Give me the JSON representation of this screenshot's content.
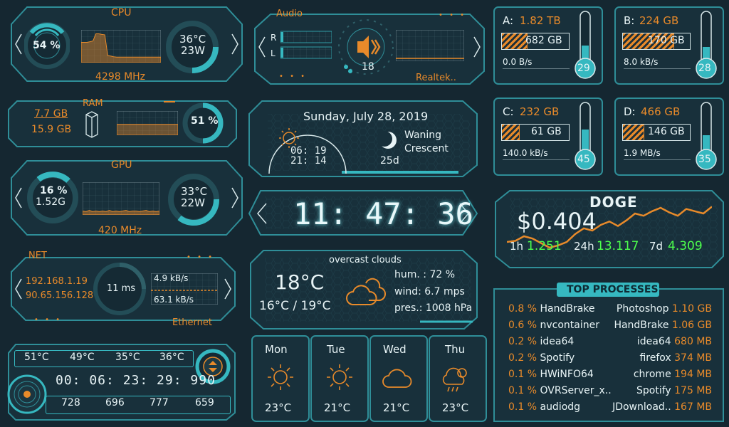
{
  "cpu": {
    "title": "CPU",
    "load": "54 %",
    "temp": "36°C",
    "power": "23W",
    "freq": "4298 MHz",
    "history": [
      0.62,
      0.62,
      0.62,
      0.64,
      0.66,
      0.88,
      0.88,
      0.86,
      0.85,
      0.22,
      0.2,
      0.18,
      0.17,
      0.17,
      0.17,
      0.17,
      0.17,
      0.17,
      0.17,
      0.17,
      0.17,
      0.17,
      0.17,
      0.17,
      0.17,
      0.17,
      0.17,
      0.17
    ]
  },
  "ram": {
    "title": "RAM",
    "used": "7.7 GB",
    "total": "15.9 GB",
    "percent": "51 %",
    "history": [
      0.45,
      0.45,
      0.45,
      0.45,
      0.45,
      0.45,
      0.45,
      0.45,
      0.45,
      0.45,
      0.45,
      0.45,
      0.45,
      0.45,
      0.45,
      0.45,
      0.45,
      0.45,
      0.45,
      0.45,
      0.45,
      0.45,
      0.45,
      0.45
    ]
  },
  "gpu": {
    "title": "GPU",
    "load": "16 %",
    "mem": "1.52G",
    "temp": "33°C",
    "power": "22W",
    "freq": "420 MHz",
    "history": [
      0.12,
      0.1,
      0.14,
      0.1,
      0.12,
      0.1,
      0.12,
      0.1,
      0.14,
      0.1,
      0.12,
      0.1,
      0.12,
      0.14,
      0.1,
      0.12,
      0.12,
      0.1,
      0.12,
      0.14,
      0.1,
      0.12,
      0.1,
      0.12
    ]
  },
  "net": {
    "title": "NET",
    "local_ip": "192.168.1.19",
    "public_ip": "90.65.156.128",
    "ping": "11 ms",
    "up": "4.9 kB/s",
    "down": "63.1 kB/s",
    "adapter": "Ethernet"
  },
  "temps": {
    "values": [
      "51°C",
      "49°C",
      "35°C",
      "36°C"
    ],
    "uptime": "00: 06: 23: 29: 990",
    "fans": [
      "728",
      "696",
      "777",
      "659"
    ]
  },
  "audio": {
    "title": "Audio",
    "left_label": "L",
    "right_label": "R",
    "volume": "18",
    "device": "Realtek.."
  },
  "calendar": {
    "date": "Sunday, July 28, 2019",
    "sunrise": "06: 19",
    "sunset": "21: 14",
    "moon_line1": "Waning",
    "moon_line2": "Crescent",
    "moon_age": "25d"
  },
  "clock": {
    "time": "11: 47: 36"
  },
  "weather": {
    "condition": "overcast clouds",
    "temp": "18°C",
    "range": "16°C / 19°C",
    "humidity": "hum. : 72 %",
    "wind": "wind: 6.7 mps",
    "pressure": "pres.: 1008 hPa",
    "forecast": [
      {
        "day": "Mon",
        "temp": "23°C",
        "icon": "sun-icon"
      },
      {
        "day": "Tue",
        "temp": "21°C",
        "icon": "sun-icon"
      },
      {
        "day": "Wed",
        "temp": "21°C",
        "icon": "cloud-icon"
      },
      {
        "day": "Thu",
        "temp": "23°C",
        "icon": "rain-icon"
      }
    ]
  },
  "drives": [
    {
      "letter": "A:",
      "size": "1.82 TB",
      "used": "682 GB",
      "fill_pct": 37,
      "io": "0.0 B/s",
      "temp": "29"
    },
    {
      "letter": "B:",
      "size": "224 GB",
      "used": "170 GB",
      "fill_pct": 76,
      "io": "8.0 kB/s",
      "temp": "28"
    },
    {
      "letter": "C:",
      "size": "232 GB",
      "used": "61 GB",
      "fill_pct": 26,
      "io": "140.0 kB/s",
      "temp": "45"
    },
    {
      "letter": "D:",
      "size": "466 GB",
      "used": "146 GB",
      "fill_pct": 31,
      "io": "1.9 MB/s",
      "temp": "35"
    }
  ],
  "crypto": {
    "name": "DOGE",
    "price": "$0.404",
    "h1_label": "1h",
    "h1": "1.251",
    "h24_label": "24h",
    "h24": "13.117",
    "d7_label": "7d",
    "d7": "4.309",
    "history": [
      0.2,
      0.22,
      0.3,
      0.26,
      0.18,
      0.1,
      0.14,
      0.2,
      0.34,
      0.44,
      0.4,
      0.5,
      0.56,
      0.48,
      0.58,
      0.7,
      0.66,
      0.74,
      0.8,
      0.72,
      0.66,
      0.78,
      0.74,
      0.7,
      0.82
    ]
  },
  "processes": {
    "title": "TOP PROCESSES",
    "cpu": [
      {
        "pct": "0.8 %",
        "name": "HandBrake"
      },
      {
        "pct": "0.6 %",
        "name": "nvcontainer"
      },
      {
        "pct": "0.2 %",
        "name": "idea64"
      },
      {
        "pct": "0.2 %",
        "name": "Spotify"
      },
      {
        "pct": "0.1 %",
        "name": "HWiNFO64"
      },
      {
        "pct": "0.1 %",
        "name": "OVRServer_x.."
      },
      {
        "pct": "0.1 %",
        "name": "audiodg"
      }
    ],
    "mem": [
      {
        "name": "Photoshop",
        "size": "1.10 GB"
      },
      {
        "name": "HandBrake",
        "size": "1.06 GB"
      },
      {
        "name": "idea64",
        "size": "680 MB"
      },
      {
        "name": "firefox",
        "size": "374 MB"
      },
      {
        "name": "chrome",
        "size": "194 MB"
      },
      {
        "name": "Spotify",
        "size": "175 MB"
      },
      {
        "name": "JDownload..",
        "size": "167 MB"
      }
    ]
  }
}
